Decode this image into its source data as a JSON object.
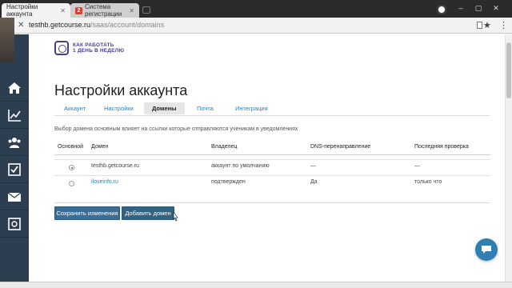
{
  "browser": {
    "tabs": [
      {
        "label": "Настройки аккаунта",
        "active": true
      },
      {
        "label": "Система регистрации",
        "active": false
      }
    ],
    "url_domain": "testhb.getcourse.ru",
    "url_path": "/saas/account/domains"
  },
  "sidebar": {
    "items": [
      {
        "icon": "home-icon"
      },
      {
        "icon": "chart-icon"
      },
      {
        "icon": "users-icon"
      },
      {
        "icon": "checkbox-icon"
      },
      {
        "icon": "mail-icon"
      },
      {
        "icon": "safe-icon"
      }
    ]
  },
  "logo": {
    "line1": "КАК РАБОТАТЬ",
    "line2": "1 ДЕНЬ В НЕДЕЛЮ"
  },
  "page": {
    "title": "Настройки аккаунта",
    "tabs": [
      {
        "label": "Аккаунт",
        "active": false
      },
      {
        "label": "Настройки",
        "active": false
      },
      {
        "label": "Домены",
        "active": true
      },
      {
        "label": "Почта",
        "active": false
      },
      {
        "label": "Интеграция",
        "active": false
      }
    ],
    "hint": "Выбор домена основным влияет на ссылки которые отправляются ученикам в уведомлениях"
  },
  "table": {
    "headers": [
      "Основной",
      "Домен",
      "Владелец",
      "DNS-перенаправление",
      "Последняя проверка"
    ],
    "rows": [
      {
        "main": true,
        "domain": "testhb.getcourse.ru",
        "owner": "аккаунт по умолчанию",
        "dns": "—",
        "last_check": "—"
      },
      {
        "main": false,
        "domain": "iloveinfo.ru",
        "owner": "подтвержден",
        "dns": "Да",
        "last_check": "только что"
      }
    ]
  },
  "actions": {
    "save_label": "Сохранить изменения",
    "add_label": "Добавить домен"
  },
  "colors": {
    "sidebar_bg": "#2d3e50",
    "primary_button": "#3a6e96",
    "link": "#2f7fb3",
    "logo": "#4a3d8f"
  }
}
